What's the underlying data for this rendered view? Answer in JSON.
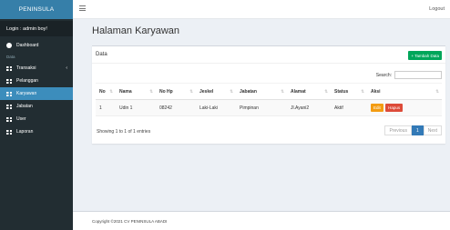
{
  "sidebar": {
    "brand": "PENINSULA",
    "user": "Login : admin boy!",
    "section_header": "Data",
    "items": [
      {
        "label": "Dashboard",
        "icon": "dashboard-icon"
      },
      {
        "label": "Transaksi",
        "icon": "grid-icon",
        "chevron": "‹"
      },
      {
        "label": "Pelanggan",
        "icon": "grid-icon"
      },
      {
        "label": "Karyawan",
        "icon": "grid-icon",
        "active": true
      },
      {
        "label": "Jabatan",
        "icon": "grid-icon"
      },
      {
        "label": "User",
        "icon": "grid-icon"
      },
      {
        "label": "Laporan",
        "icon": "grid-icon"
      }
    ]
  },
  "topbar": {
    "menu_glyph": "≡",
    "logout": "Logout"
  },
  "page": {
    "title": "Halaman Karyawan"
  },
  "box": {
    "header": "Data",
    "add_button": "+ Tambah Data",
    "search_label": "Search:",
    "search_value": ""
  },
  "table": {
    "columns": [
      "No",
      "Nama",
      "No Hp",
      "Jeskel",
      "Jabatan",
      "Alamat",
      "Status",
      "Aksi"
    ],
    "rows": [
      {
        "no": "1",
        "nama": "Udin 1",
        "nohp": "08242",
        "jeskel": "Laki-Laki",
        "jabatan": "Pimpinan",
        "alamat": "Jl.Ayani2",
        "status": "Aktif"
      }
    ],
    "edit_label": "Edit",
    "delete_label": "Hapus"
  },
  "pagination": {
    "info": "Showing 1 to 1 of 1 entries",
    "previous": "Previous",
    "page": "1",
    "next": "Next"
  },
  "footer": {
    "text": "Copyright ©2021 CV PENINSULA ABADI"
  },
  "colors": {
    "sidebar": "#222d32",
    "brand": "#367fa9",
    "active": "#3c8dbc",
    "add_button": "#00a65a",
    "edit_button": "#f39c12",
    "delete_button": "#dd4b39"
  }
}
